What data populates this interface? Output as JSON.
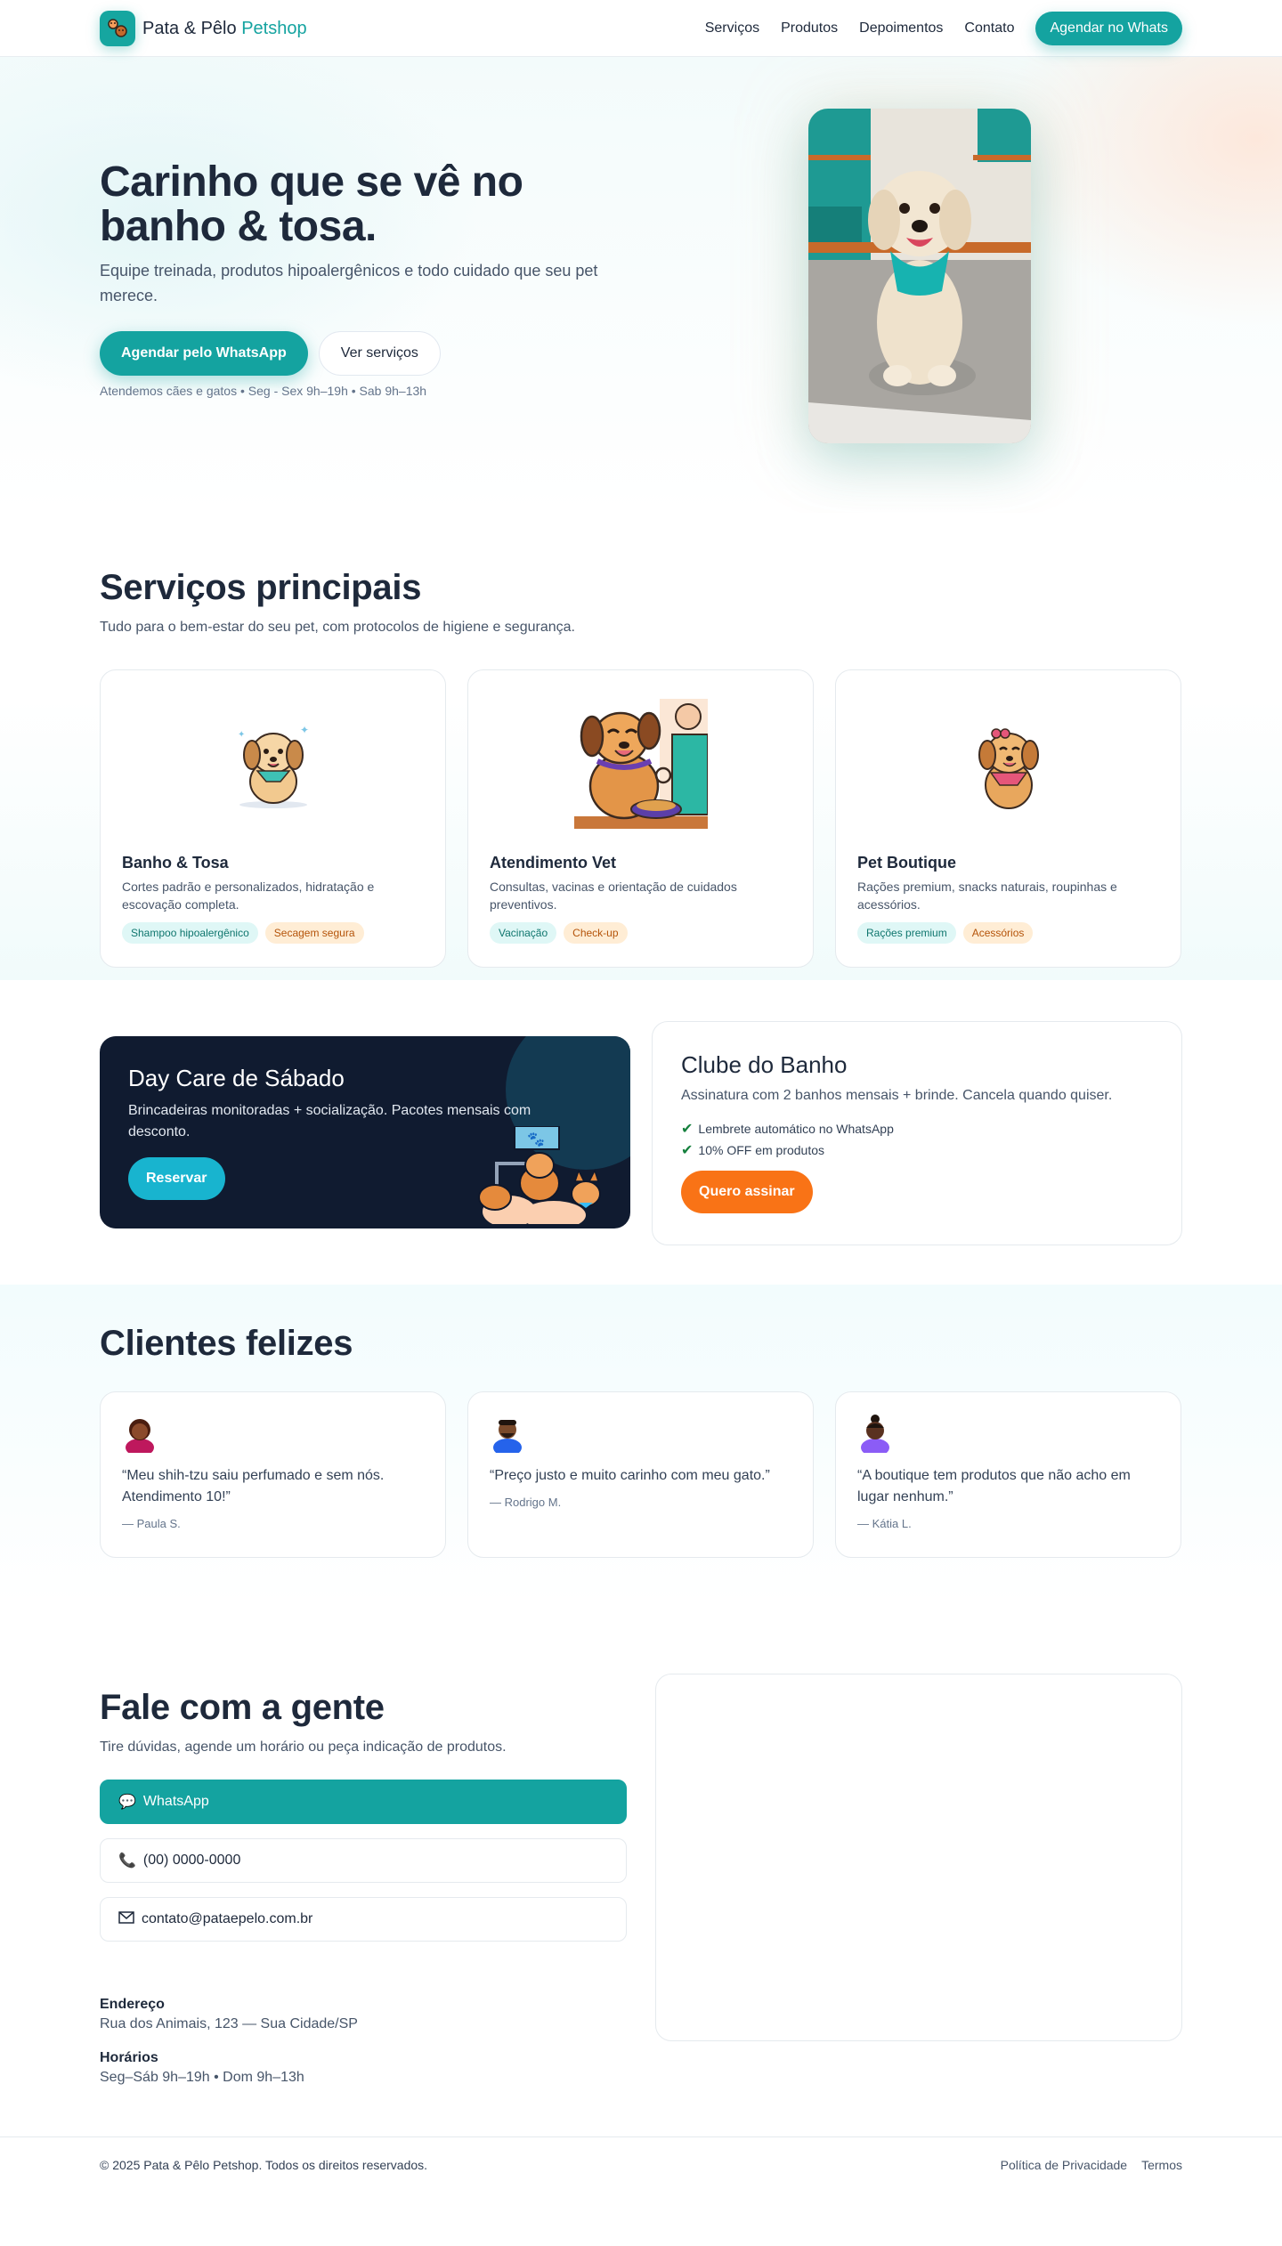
{
  "nav": {
    "brand_main": "Pata & Pêlo",
    "brand_accent": "Petshop",
    "links": [
      "Serviços",
      "Produtos",
      "Depoimentos",
      "Contato"
    ],
    "cta": "Agendar no Whats"
  },
  "hero": {
    "title": "Carinho que se vê no banho & tosa.",
    "subtitle": "Equipe treinada, produtos hipoalergênicos e todo cuidado que seu pet merece.",
    "primary_btn": "Agendar pelo WhatsApp",
    "secondary_btn": "Ver serviços",
    "note": "Atendemos cães e gatos • Seg - Sex 9h–19h • Sab 9h–13h"
  },
  "services": {
    "title": "Serviços principais",
    "subtitle": "Tudo para o bem-estar do seu pet, com protocolos de higiene e segurança.",
    "items": [
      {
        "title": "Banho & Tosa",
        "desc": "Cortes padrão e personalizados, hidratação e escovação completa.",
        "tags": [
          "Shampoo hipoalergênico",
          "Secagem segura"
        ]
      },
      {
        "title": "Atendimento Vet",
        "desc": "Consultas, vacinas e orientação de cuidados preventivos.",
        "tags": [
          "Vacinação",
          "Check-up"
        ]
      },
      {
        "title": "Pet Boutique",
        "desc": "Rações premium, snacks naturais, roupinhas e acessórios.",
        "tags": [
          "Rações premium",
          "Acessórios"
        ]
      }
    ]
  },
  "daycare": {
    "title": "Day Care de Sábado",
    "desc": "Brincadeiras monitoradas + socialização. Pacotes mensais com desconto.",
    "btn": "Reservar"
  },
  "club": {
    "title": "Clube do Banho",
    "desc": "Assinatura com 2 banhos mensais + brinde. Cancela quando quiser.",
    "perks": [
      "Lembrete automático no WhatsApp",
      "10% OFF em produtos"
    ],
    "btn": "Quero assinar"
  },
  "testimonials": {
    "title": "Clientes felizes",
    "items": [
      {
        "quote": "“Meu shih-tzu saiu perfumado e sem nós. Atendimento 10!”",
        "author": "— Paula S."
      },
      {
        "quote": "“Preço justo e muito carinho com meu gato.”",
        "author": "— Rodrigo M."
      },
      {
        "quote": "“A boutique tem produtos que não acho em lugar nenhum.”",
        "author": "— Kátia L."
      }
    ]
  },
  "contact": {
    "title": "Fale com a gente",
    "subtitle": "Tire dúvidas, agende um horário ou peça indicação de produtos.",
    "whatsapp": "WhatsApp",
    "phone": "(00) 0000-0000",
    "email": "contato@pataepelo.com.br",
    "address_label": "Endereço",
    "address": "Rua dos Animais, 123 — Sua Cidade/SP",
    "hours_label": "Horários",
    "hours": "Seg–Sáb 9h–19h • Dom 9h–13h"
  },
  "footer": {
    "copyright": "© 2025 Pata & Pêlo Petshop. Todos os direitos reservados.",
    "links": [
      "Política de Privacidade",
      "Termos"
    ]
  },
  "colors": {
    "brand": "#14a3a0",
    "orange": "#f97316",
    "navy": "#101b30"
  }
}
